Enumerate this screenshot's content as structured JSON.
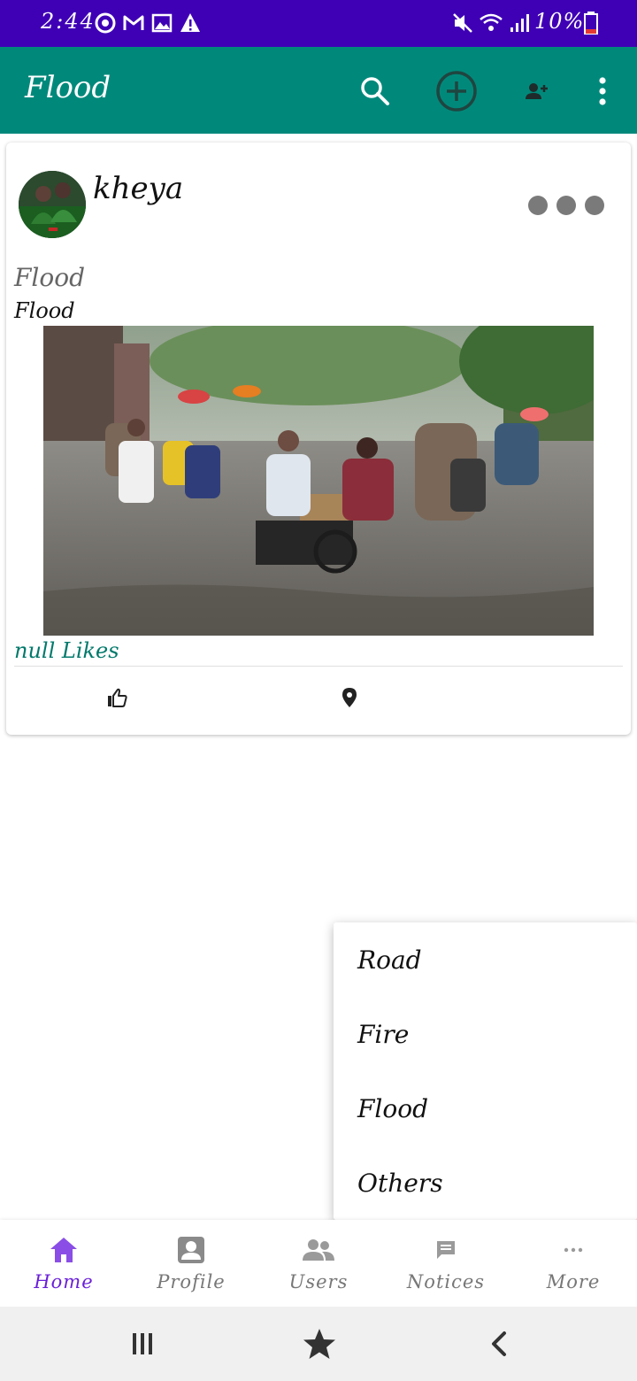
{
  "status_bar": {
    "time": "2:44",
    "battery_percent": "10%",
    "icons": [
      "sync-icon",
      "gmail-icon",
      "gallery-icon",
      "warning-icon",
      "mute-icon",
      "wifi-icon",
      "signal-icon",
      "battery-icon"
    ]
  },
  "app_bar": {
    "title": "Flood",
    "actions": [
      "search-icon",
      "add-circle-icon",
      "add-user-icon",
      "more-vert-icon"
    ]
  },
  "post": {
    "username": "kheya",
    "title": "Flood",
    "description": "Flood",
    "likes_text": "null Likes",
    "image_subject": "flooded city street with rickshaws"
  },
  "dropdown_menu": {
    "items": [
      "Road",
      "Fire",
      "Flood",
      "Others"
    ]
  },
  "bottom_nav": {
    "items": [
      {
        "label": "Home",
        "icon": "home-icon",
        "active": true
      },
      {
        "label": "Profile",
        "icon": "profile-icon",
        "active": false
      },
      {
        "label": "Users",
        "icon": "users-icon",
        "active": false
      },
      {
        "label": "Notices",
        "icon": "notices-icon",
        "active": false
      },
      {
        "label": "More",
        "icon": "more-horiz-icon",
        "active": false
      }
    ]
  },
  "colors": {
    "status_bar": "#3f00b5",
    "app_bar": "#00897b",
    "active_nav": "#6a1fd8",
    "likes_text": "#00796b"
  }
}
